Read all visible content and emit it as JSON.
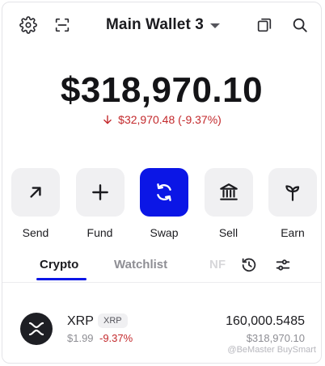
{
  "header": {
    "wallet_name": "Main Wallet 3",
    "icons": [
      "settings-gear-icon",
      "scan-qr-icon",
      "copy-icon",
      "search-icon"
    ]
  },
  "balance": {
    "total": "$318,970.10",
    "change_text": "$32,970.48 (-9.37%)",
    "change_direction": "down",
    "change_color": "#c3292c"
  },
  "actions": [
    {
      "label": "Send",
      "icon": "arrow-up-right-icon"
    },
    {
      "label": "Fund",
      "icon": "plus-icon"
    },
    {
      "label": "Swap",
      "icon": "swap-icon",
      "primary": true
    },
    {
      "label": "Sell",
      "icon": "bank-icon"
    },
    {
      "label": "Earn",
      "icon": "sprout-icon"
    }
  ],
  "tabs": [
    {
      "label": "Crypto",
      "active": true
    },
    {
      "label": "Watchlist",
      "active": false
    },
    {
      "label": "NF",
      "active": false
    }
  ],
  "assets": [
    {
      "name": "XRP",
      "ticker": "XRP",
      "price": "$1.99",
      "change": "-9.37%",
      "quantity": "160,000.5485",
      "value": "$318,970.10"
    }
  ],
  "watermark": "@BeMaster BuySmart",
  "colors": {
    "accent": "#0b16e6",
    "negative": "#c3292c"
  }
}
